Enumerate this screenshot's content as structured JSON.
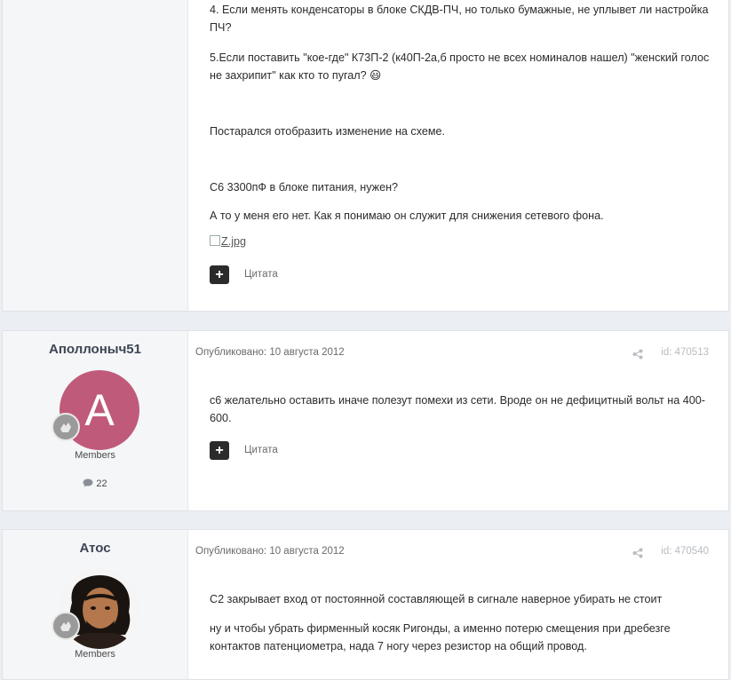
{
  "posts": [
    {
      "paragraphs": [
        "4. Если менять конденсаторы в блоке СКДВ-ПЧ, но только бумажные, не уплывет ли настройка ПЧ?",
        "5.Если поставить \"кое-где\" К73П-2 (к40П-2а,б просто не всех номиналов нашел) \"женский голос не захрипит\" как кто то пугал? 😃",
        "Постарался отобразить изменение на схеме.",
        "С6 3300пФ в блоке питания, нужен?",
        "А то у меня его нет. Как я понимаю он служит для снижения сетевого фона."
      ],
      "image_alt": "Z.jpg",
      "quote_button": "+",
      "quote_label": "Цитата"
    },
    {
      "author": "Аполлоныч51",
      "avatar_letter": "A",
      "avatar_color": "#c05a7a",
      "group": "Members",
      "post_count": "22",
      "published": "Опубликовано: 10 августа 2012",
      "post_id": "id: 470513",
      "paragraphs": [
        "с6 желательно оставить иначе полезут помехи из сети. Вроде он не дефицитный вольт на 400-600."
      ],
      "quote_button": "+",
      "quote_label": "Цитата"
    },
    {
      "author": "Атос",
      "group": "Members",
      "published": "Опубликовано: 10 августа 2012",
      "post_id": "id: 470540",
      "paragraphs": [
        "С2 закрывает вход от постоянной составляющей в сигнале наверное убирать не стоит",
        "ну и чтобы убрать фирменный косяк Ригонды, а именно потерю смещения при дребезге контактов патенциометра, нада 7 ногу через резистор на общий провод."
      ]
    }
  ],
  "icons": {
    "share": "share-icon",
    "comment": "comment-icon",
    "rank": "rank-badge-icon"
  }
}
